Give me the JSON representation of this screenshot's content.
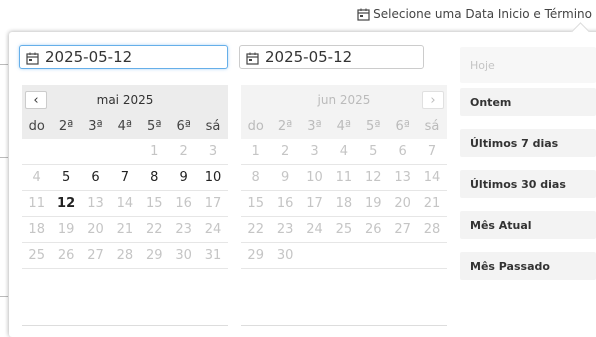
{
  "trigger": {
    "label": "Selecione uma Data Inicio e Término",
    "icon": "calendar-icon"
  },
  "start_input": {
    "value": "2025-05-12",
    "icon": "calendar-icon"
  },
  "end_input": {
    "value": "2025-05-12",
    "icon": "calendar-icon"
  },
  "left_calendar": {
    "title": "mai 2025",
    "prev_label": "‹",
    "weekdays": [
      "do",
      "2ª",
      "3ª",
      "4ª",
      "5ª",
      "6ª",
      "sá"
    ],
    "weeks": [
      [
        "",
        "",
        "",
        "",
        "1",
        "2",
        "3"
      ],
      [
        "4",
        "5",
        "6",
        "7",
        "8",
        "9",
        "10"
      ],
      [
        "11",
        "12",
        "13",
        "14",
        "15",
        "16",
        "17"
      ],
      [
        "18",
        "19",
        "20",
        "21",
        "22",
        "23",
        "24"
      ],
      [
        "25",
        "26",
        "27",
        "28",
        "29",
        "30",
        "31"
      ]
    ],
    "selected": "12"
  },
  "right_calendar": {
    "title": "jun 2025",
    "next_label": "›",
    "weekdays": [
      "do",
      "2ª",
      "3ª",
      "4ª",
      "5ª",
      "6ª",
      "sá"
    ],
    "weeks": [
      [
        "1",
        "2",
        "3",
        "4",
        "5",
        "6",
        "7"
      ],
      [
        "8",
        "9",
        "10",
        "11",
        "12",
        "13",
        "14"
      ],
      [
        "15",
        "16",
        "17",
        "18",
        "19",
        "20",
        "21"
      ],
      [
        "22",
        "23",
        "24",
        "25",
        "26",
        "27",
        "28"
      ],
      [
        "29",
        "30",
        "",
        "",
        "",
        "",
        ""
      ]
    ]
  },
  "ranges": [
    {
      "label": "Hoje",
      "active": false
    },
    {
      "label": "Ontem",
      "active": true
    },
    {
      "label": "Últimos 7 dias",
      "active": true
    },
    {
      "label": "Últimos 30 dias",
      "active": true
    },
    {
      "label": "Mês Atual",
      "active": true
    },
    {
      "label": "Mês Passado",
      "active": true
    }
  ]
}
